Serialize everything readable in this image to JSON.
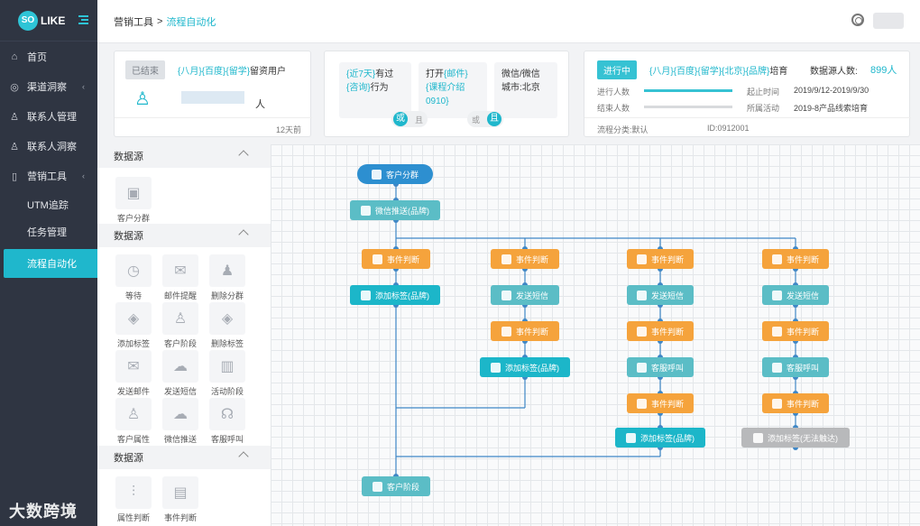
{
  "brand": {
    "badge": "SO",
    "name": "LIKE"
  },
  "nav": {
    "home": "首页",
    "channel": "渠道洞察",
    "contacts": "联系人管理",
    "contact_insight": "联系人洞察",
    "marketing": "营销工具",
    "utm": "UTM追踪",
    "tasks": "任务管理",
    "automation": "流程自动化"
  },
  "breadcrumb": {
    "parent": "营销工具",
    "sep": ">",
    "current": "流程自动化"
  },
  "card1": {
    "status": "已结束",
    "tags": "{八月}{百度}{留学}",
    "title_suffix": "留资用户",
    "unit": "人",
    "time": "12天前"
  },
  "card2": {
    "box1_line1": "{近7天}有过",
    "box1_line2": "{咨询}行为",
    "box2_line1": "打开{邮件}",
    "box2_line2": "{课程介绍",
    "box2_line3": "0910}",
    "box3_line1": "微信/微信",
    "box3_line2": "城市:北京",
    "or_active": "或",
    "or_inactive": "且",
    "and_inactive": "或",
    "and_active": "且"
  },
  "card3": {
    "status": "进行中",
    "tags": "{八月}{百度}{留学}{北京}{品牌}",
    "title_suffix": "培育",
    "count_label": "数据源人数:",
    "count": "899人",
    "running_label": "进行人数",
    "ended_label": "结束人数",
    "date_label": "起止时间",
    "date_value": "2019/9/12-2019/9/30",
    "activity_label": "所属活动",
    "activity_value": "2019-8产品线索培育",
    "category": "流程分类:默认",
    "id": "ID:0912001"
  },
  "panel": {
    "section1": "数据源",
    "section2": "数据源",
    "section3": "数据源",
    "tools1": [
      "客户分群"
    ],
    "tools2": [
      "等待",
      "邮件提醒",
      "删除分群",
      "添加标签",
      "客户阶段",
      "删除标签",
      "发送邮件",
      "发送短信",
      "活动阶段",
      "客户属性",
      "微信推送",
      "客服呼叫"
    ],
    "tools3": [
      "属性判断",
      "事件判断"
    ]
  },
  "flow": {
    "start": "客户分群",
    "wechat": "微信推送(品牌)",
    "event": "事件判断",
    "add_tag": "添加标签(品牌)",
    "sms": "发送短信",
    "call": "客服呼叫",
    "add_tag_fail": "添加标签(无法触达)",
    "stage": "客户阶段"
  },
  "watermark": "大数跨境",
  "colors": {
    "accent": "#1fb7cc",
    "orange": "#f5a33c",
    "teal": "#5bbdc6",
    "blue": "#2d8fd0",
    "sidebar": "#2f3542"
  }
}
